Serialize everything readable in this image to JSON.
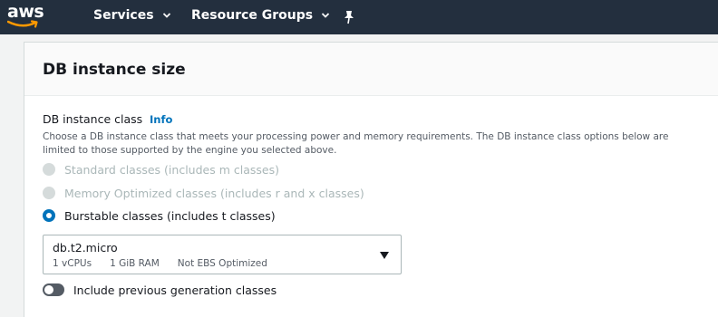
{
  "nav": {
    "logo_text": "aws",
    "services_label": "Services",
    "resource_groups_label": "Resource Groups"
  },
  "panel": {
    "title": "DB instance size",
    "field_label": "DB instance class",
    "info_label": "Info",
    "description": "Choose a DB instance class that meets your processing power and memory requirements. The DB instance class options below are limited to those supported by the engine you selected above.",
    "options": [
      {
        "label": "Standard classes (includes m classes)",
        "state": "disabled"
      },
      {
        "label": "Memory Optimized classes (includes r and x classes)",
        "state": "disabled"
      },
      {
        "label": "Burstable classes (includes t classes)",
        "state": "selected"
      }
    ],
    "select": {
      "value": "db.t2.micro",
      "vcpus": "1 vCPUs",
      "ram": "1 GiB RAM",
      "ebs": "Not EBS Optimized"
    },
    "toggle_label": "Include previous generation classes",
    "toggle_on": false
  },
  "colors": {
    "nav_bg": "#232f3e",
    "accent": "#0073bb",
    "disabled": "#aab7b8"
  }
}
